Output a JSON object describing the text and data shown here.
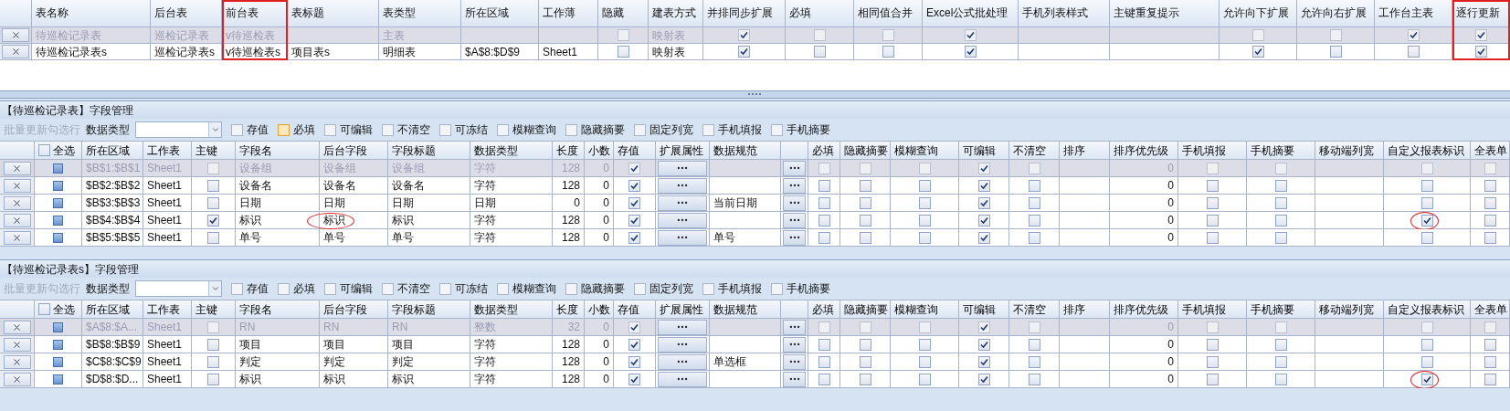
{
  "top_grid": {
    "columns": [
      {
        "label": "表名称",
        "kind": "text",
        "highlighted": false
      },
      {
        "label": "后台表",
        "kind": "text",
        "highlighted": false
      },
      {
        "label": "前台表",
        "kind": "text",
        "highlighted": true
      },
      {
        "label": "表标题",
        "kind": "text",
        "highlighted": false
      },
      {
        "label": "表类型",
        "kind": "text",
        "highlighted": false
      },
      {
        "label": "所在区域",
        "kind": "text",
        "highlighted": false
      },
      {
        "label": "工作薄",
        "kind": "text",
        "highlighted": false
      },
      {
        "label": "隐藏",
        "kind": "check",
        "highlighted": false
      },
      {
        "label": "建表方式",
        "kind": "text",
        "highlighted": false
      },
      {
        "label": "并排同步扩展",
        "kind": "check",
        "highlighted": false
      },
      {
        "label": "必填",
        "kind": "check",
        "highlighted": false
      },
      {
        "label": "相同值合并",
        "kind": "check",
        "highlighted": false
      },
      {
        "label": "Excel公式批处理",
        "kind": "check",
        "highlighted": false
      },
      {
        "label": "手机列表样式",
        "kind": "text",
        "highlighted": false
      },
      {
        "label": "主键重复提示",
        "kind": "text",
        "highlighted": false
      },
      {
        "label": "允许向下扩展",
        "kind": "check",
        "highlighted": false
      },
      {
        "label": "允许向右扩展",
        "kind": "check",
        "highlighted": false
      },
      {
        "label": "工作台主表",
        "kind": "check",
        "highlighted": false
      },
      {
        "label": "逐行更新",
        "kind": "check",
        "highlighted": true
      }
    ],
    "rows": [
      {
        "disabled": true,
        "cells": [
          "待巡检记录表",
          "巡检记录表",
          "v待巡检表",
          null,
          "主表",
          null,
          null,
          false,
          "映射表",
          true,
          false,
          false,
          true,
          null,
          null,
          false,
          false,
          true,
          true
        ]
      },
      {
        "disabled": false,
        "cells": [
          "待巡检记录表s",
          "巡检记录表s",
          "v待巡检表s",
          "项目表s",
          "明细表",
          "$A$8:$D$9",
          "Sheet1",
          false,
          "映射表",
          true,
          false,
          false,
          true,
          null,
          null,
          true,
          false,
          false,
          true
        ]
      }
    ]
  },
  "field_sections": [
    {
      "title": "【待巡检记录表】字段管理",
      "toolbar": {
        "batch_button": "批量更新勾选行",
        "batch_disabled": true,
        "type_label": "数据类型",
        "filters": [
          {
            "label": "存值",
            "checked": false,
            "focused": false
          },
          {
            "label": "必填",
            "checked": false,
            "focused": true
          },
          {
            "label": "可编辑",
            "checked": false,
            "focused": false
          },
          {
            "label": "不清空",
            "checked": false,
            "focused": false
          },
          {
            "label": "可冻结",
            "checked": false,
            "focused": false
          },
          {
            "label": "模糊查询",
            "checked": false,
            "focused": false
          },
          {
            "label": "隐藏摘要",
            "checked": false,
            "focused": false
          },
          {
            "label": "固定列宽",
            "checked": false,
            "focused": false
          },
          {
            "label": "手机填报",
            "checked": false,
            "focused": false
          },
          {
            "label": "手机摘要",
            "checked": false,
            "focused": false
          }
        ]
      },
      "select_all": {
        "label": "全选",
        "checked": false
      },
      "columns": [
        {
          "label": "所在区域",
          "kind": "text"
        },
        {
          "label": "工作表",
          "kind": "text"
        },
        {
          "label": "主键",
          "kind": "check"
        },
        {
          "label": "字段名",
          "kind": "text"
        },
        {
          "label": "后台字段",
          "kind": "text"
        },
        {
          "label": "字段标题",
          "kind": "text"
        },
        {
          "label": "数据类型",
          "kind": "text"
        },
        {
          "label": "长度",
          "kind": "num"
        },
        {
          "label": "小数",
          "kind": "num"
        },
        {
          "label": "存值",
          "kind": "check"
        },
        {
          "label": "扩展属性",
          "kind": "button"
        },
        {
          "label": "数据规范",
          "kind": "text"
        },
        {
          "kind": "button"
        },
        {
          "label": "必填",
          "kind": "check"
        },
        {
          "label": "隐藏摘要",
          "kind": "check"
        },
        {
          "label": "模糊查询",
          "kind": "check"
        },
        {
          "label": "可编辑",
          "kind": "check"
        },
        {
          "label": "不清空",
          "kind": "check"
        },
        {
          "label": "排序",
          "kind": "text"
        },
        {
          "label": "排序优先级",
          "kind": "num"
        },
        {
          "label": "手机填报",
          "kind": "check"
        },
        {
          "label": "手机摘要",
          "kind": "check"
        },
        {
          "label": "移动端列宽",
          "kind": "text"
        },
        {
          "label": "自定义报表标识",
          "kind": "check"
        },
        {
          "label": "全表单",
          "kind": "check"
        }
      ],
      "rows": [
        {
          "disabled": true,
          "cells": [
            "$B$1:$B$1",
            "Sheet1",
            false,
            "设备组",
            "设备组",
            "设备组",
            "字符",
            "128",
            "0",
            true,
            null,
            null,
            null,
            false,
            false,
            false,
            true,
            false,
            null,
            "0",
            false,
            false,
            null,
            false,
            false
          ]
        },
        {
          "disabled": false,
          "cells": [
            "$B$2:$B$2",
            "Sheet1",
            false,
            "设备名",
            "设备名",
            "设备名",
            "字符",
            "128",
            "0",
            true,
            null,
            null,
            null,
            false,
            false,
            false,
            true,
            false,
            null,
            "0",
            false,
            false,
            null,
            false,
            false
          ]
        },
        {
          "disabled": false,
          "cells": [
            "$B$3:$B$3",
            "Sheet1",
            false,
            "日期",
            "日期",
            "日期",
            "日期",
            "0",
            "0",
            true,
            null,
            "当前日期",
            null,
            false,
            false,
            false,
            true,
            false,
            null,
            "0",
            false,
            false,
            null,
            false,
            false
          ]
        },
        {
          "disabled": false,
          "cells": [
            "$B$4:$B$4",
            "Sheet1",
            true,
            "标识",
            {
              "value": "标识",
              "circled": true
            },
            "标识",
            "字符",
            "128",
            "0",
            true,
            null,
            null,
            null,
            false,
            false,
            false,
            true,
            false,
            null,
            "0",
            false,
            false,
            null,
            {
              "checked": true,
              "circled": true
            },
            false
          ]
        },
        {
          "disabled": false,
          "cells": [
            "$B$5:$B$5",
            "Sheet1",
            false,
            "单号",
            "单号",
            "单号",
            "字符",
            "128",
            "0",
            true,
            null,
            "单号",
            null,
            false,
            false,
            false,
            true,
            false,
            null,
            "0",
            false,
            false,
            null,
            false,
            false
          ]
        }
      ]
    },
    {
      "title": "【待巡检记录表s】字段管理",
      "toolbar": {
        "batch_button": "批量更新勾选行",
        "batch_disabled": true,
        "type_label": "数据类型",
        "filters": [
          {
            "label": "存值",
            "checked": false,
            "focused": false
          },
          {
            "label": "必填",
            "checked": false,
            "focused": false
          },
          {
            "label": "可编辑",
            "checked": false,
            "focused": false
          },
          {
            "label": "不清空",
            "checked": false,
            "focused": false
          },
          {
            "label": "可冻结",
            "checked": false,
            "focused": false
          },
          {
            "label": "模糊查询",
            "checked": false,
            "focused": false
          },
          {
            "label": "隐藏摘要",
            "checked": false,
            "focused": false
          },
          {
            "label": "固定列宽",
            "checked": false,
            "focused": false
          },
          {
            "label": "手机填报",
            "checked": false,
            "focused": false
          },
          {
            "label": "手机摘要",
            "checked": false,
            "focused": false
          }
        ]
      },
      "select_all": {
        "label": "全选",
        "checked": false
      },
      "columns": [
        {
          "label": "所在区域",
          "kind": "text"
        },
        {
          "label": "工作表",
          "kind": "text"
        },
        {
          "label": "主键",
          "kind": "check"
        },
        {
          "label": "字段名",
          "kind": "text"
        },
        {
          "label": "后台字段",
          "kind": "text"
        },
        {
          "label": "字段标题",
          "kind": "text"
        },
        {
          "label": "数据类型",
          "kind": "text"
        },
        {
          "label": "长度",
          "kind": "num"
        },
        {
          "label": "小数",
          "kind": "num"
        },
        {
          "label": "存值",
          "kind": "check"
        },
        {
          "label": "扩展属性",
          "kind": "button"
        },
        {
          "label": "数据规范",
          "kind": "text"
        },
        {
          "kind": "button"
        },
        {
          "label": "必填",
          "kind": "check"
        },
        {
          "label": "隐藏摘要",
          "kind": "check"
        },
        {
          "label": "模糊查询",
          "kind": "check"
        },
        {
          "label": "可编辑",
          "kind": "check"
        },
        {
          "label": "不清空",
          "kind": "check"
        },
        {
          "label": "排序",
          "kind": "text"
        },
        {
          "label": "排序优先级",
          "kind": "num"
        },
        {
          "label": "手机填报",
          "kind": "check"
        },
        {
          "label": "手机摘要",
          "kind": "check"
        },
        {
          "label": "移动端列宽",
          "kind": "text"
        },
        {
          "label": "自定义报表标识",
          "kind": "check"
        },
        {
          "label": "全表单",
          "kind": "check"
        }
      ],
      "rows": [
        {
          "disabled": true,
          "cells": [
            "$A$8:$A...",
            "Sheet1",
            false,
            "RN",
            "RN",
            "RN",
            "整数",
            "32",
            "0",
            true,
            null,
            null,
            null,
            false,
            false,
            false,
            true,
            false,
            null,
            "0",
            false,
            false,
            null,
            false,
            false
          ]
        },
        {
          "disabled": false,
          "cells": [
            "$B$8:$B$9",
            "Sheet1",
            false,
            "项目",
            "项目",
            "项目",
            "字符",
            "128",
            "0",
            true,
            null,
            null,
            null,
            false,
            false,
            false,
            true,
            false,
            null,
            "0",
            false,
            false,
            null,
            false,
            false
          ]
        },
        {
          "disabled": false,
          "cells": [
            "$C$8:$C$9",
            "Sheet1",
            false,
            "判定",
            "判定",
            "判定",
            "字符",
            "128",
            "0",
            true,
            null,
            "单选框",
            null,
            false,
            false,
            false,
            true,
            false,
            null,
            "0",
            false,
            false,
            null,
            false,
            false
          ]
        },
        {
          "disabled": false,
          "cells": [
            "$D$8:$D...",
            "Sheet1",
            false,
            "标识",
            "标识",
            "标识",
            "字符",
            "128",
            "0",
            true,
            null,
            null,
            null,
            false,
            false,
            false,
            true,
            false,
            null,
            "0",
            false,
            false,
            null,
            {
              "checked": true,
              "circled": true
            },
            false
          ]
        }
      ]
    }
  ]
}
